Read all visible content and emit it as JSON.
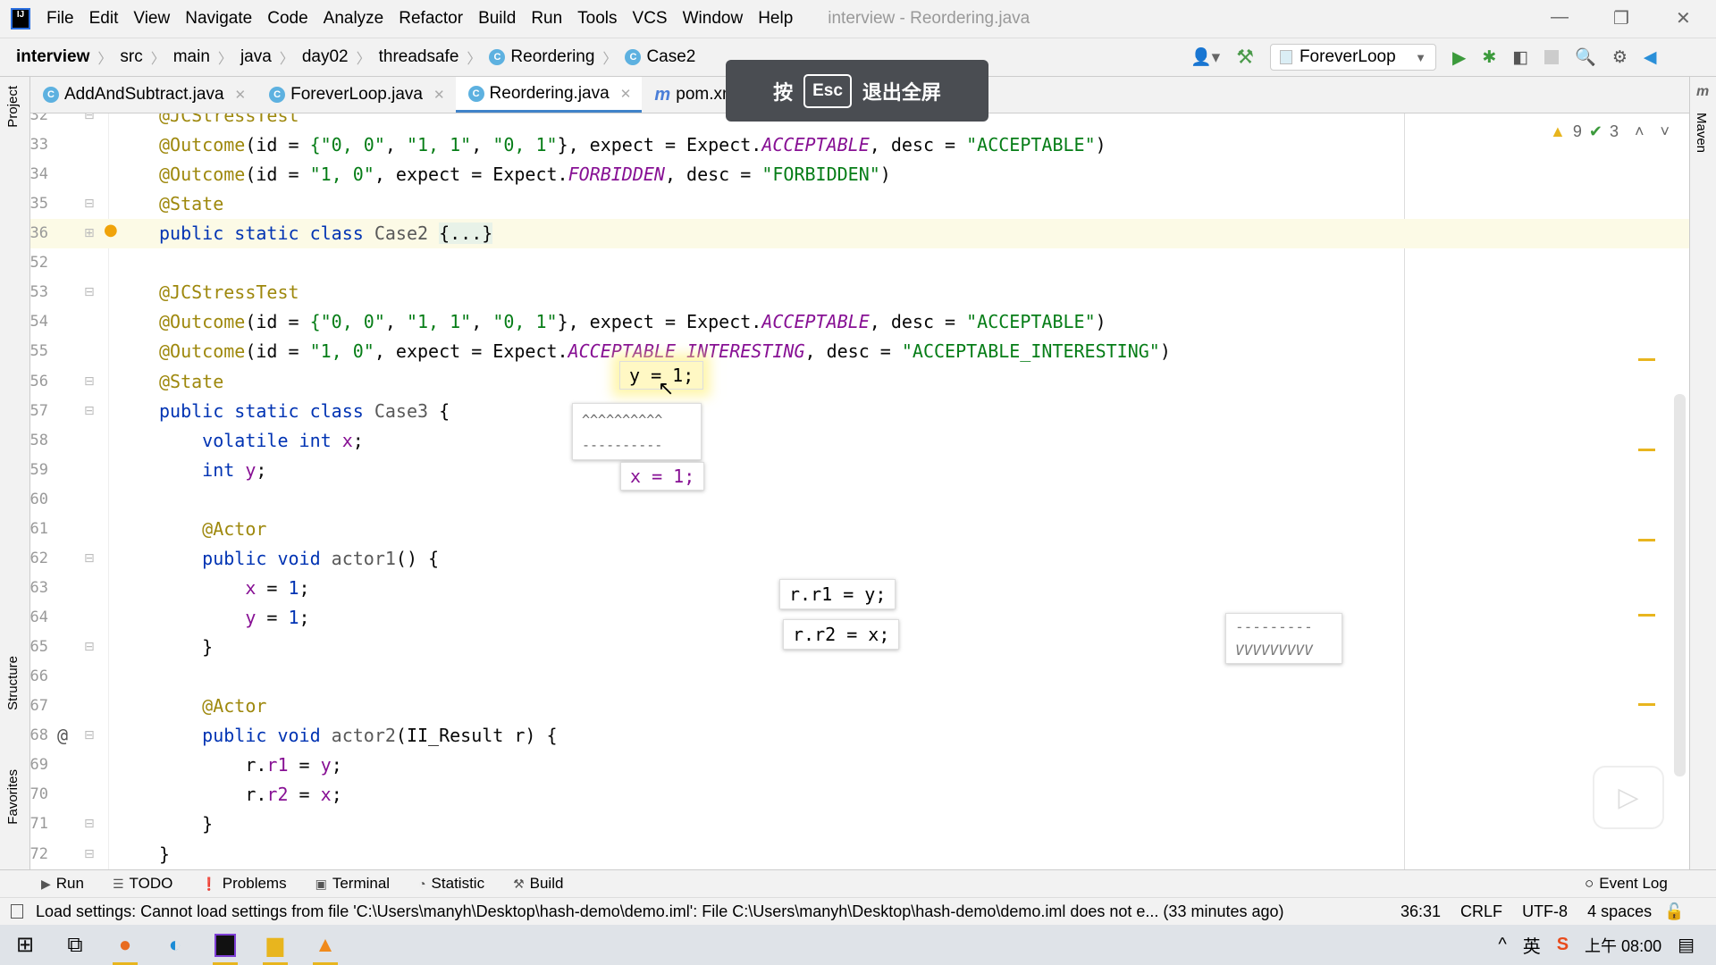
{
  "window": {
    "title": "interview - Reordering.java",
    "minimize": "—",
    "restore": "❐",
    "close": "✕"
  },
  "menu": [
    "File",
    "Edit",
    "View",
    "Navigate",
    "Code",
    "Analyze",
    "Refactor",
    "Build",
    "Run",
    "Tools",
    "VCS",
    "Window",
    "Help"
  ],
  "breadcrumb": [
    "interview",
    "src",
    "main",
    "java",
    "day02",
    "threadsafe",
    "Reordering",
    "Case2"
  ],
  "toolbar": {
    "run_config": "ForeverLoop"
  },
  "tabs": [
    {
      "label": "AddAndSubtract.java",
      "icon": "C"
    },
    {
      "label": "ForeverLoop.java",
      "icon": "C"
    },
    {
      "label": "Reordering.java",
      "icon": "C",
      "active": true
    },
    {
      "label": "pom.xml (interview)",
      "icon": "m"
    }
  ],
  "overlay": {
    "prefix": "按",
    "key": "Esc",
    "suffix": "退出全屏"
  },
  "inspections": {
    "warnings": "9",
    "weak_warnings": "3"
  },
  "side": {
    "project": "Project",
    "structure": "Structure",
    "favorites": "Favorites",
    "maven": "Maven"
  },
  "code": {
    "lines": [
      {
        "n": "32",
        "t": [
          [
            "@JCStressTest",
            "a"
          ]
        ]
      },
      {
        "n": "33",
        "t": [
          [
            "@Outcome",
            "a"
          ],
          [
            "(id = ",
            "p"
          ],
          [
            "{\"0, 0\"",
            "s"
          ],
          [
            ", ",
            "p"
          ],
          [
            "\"1, 1\"",
            "s"
          ],
          [
            ", ",
            "p"
          ],
          [
            "\"0, 1\"",
            "s"
          ],
          [
            "}, expect = Expect.",
            "p"
          ],
          [
            "ACCEPTABLE",
            "c"
          ],
          [
            ", desc = ",
            "p"
          ],
          [
            "\"ACCEPTABLE\"",
            "s"
          ],
          [
            ")",
            "p"
          ]
        ]
      },
      {
        "n": "34",
        "t": [
          [
            "@Outcome",
            "a"
          ],
          [
            "(id = ",
            "p"
          ],
          [
            "\"1, 0\"",
            "s"
          ],
          [
            ", expect = Expect.",
            "p"
          ],
          [
            "FORBIDDEN",
            "c"
          ],
          [
            ", desc = ",
            "p"
          ],
          [
            "\"FORBIDDEN\"",
            "s"
          ],
          [
            ")",
            "p"
          ]
        ]
      },
      {
        "n": "35",
        "t": [
          [
            "@State",
            "a"
          ]
        ]
      },
      {
        "n": "36",
        "cur": true,
        "t": [
          [
            "public static class ",
            "k"
          ],
          [
            "Case2 ",
            "g"
          ],
          [
            "{...}",
            "fold"
          ]
        ]
      },
      {
        "n": "52",
        "t": []
      },
      {
        "n": "53",
        "t": [
          [
            "@JCStressTest",
            "a"
          ]
        ]
      },
      {
        "n": "54",
        "t": [
          [
            "@Outcome",
            "a"
          ],
          [
            "(id = ",
            "p"
          ],
          [
            "{\"0, 0\"",
            "s"
          ],
          [
            ", ",
            "p"
          ],
          [
            "\"1, 1\"",
            "s"
          ],
          [
            ", ",
            "p"
          ],
          [
            "\"0, 1\"",
            "s"
          ],
          [
            "}, expect = Expect.",
            "p"
          ],
          [
            "ACCEPTABLE",
            "c"
          ],
          [
            ", desc = ",
            "p"
          ],
          [
            "\"ACCEPTABLE\"",
            "s"
          ],
          [
            ")",
            "p"
          ]
        ]
      },
      {
        "n": "55",
        "t": [
          [
            "@Outcome",
            "a"
          ],
          [
            "(id = ",
            "p"
          ],
          [
            "\"1, 0\"",
            "s"
          ],
          [
            ", expect = Expect.",
            "p"
          ],
          [
            "ACCEPTABLE_INTERESTING",
            "c"
          ],
          [
            ", desc = ",
            "p"
          ],
          [
            "\"ACCEPTABLE_INTERESTING\"",
            "s"
          ],
          [
            ")",
            "p"
          ]
        ]
      },
      {
        "n": "56",
        "t": [
          [
            "@State",
            "a"
          ]
        ]
      },
      {
        "n": "57",
        "t": [
          [
            "public static class ",
            "k"
          ],
          [
            "Case3 ",
            "g"
          ],
          [
            "{",
            "p"
          ]
        ]
      },
      {
        "n": "58",
        "t": [
          [
            "    volatile int ",
            "k"
          ],
          [
            "x",
            "f"
          ],
          [
            ";",
            "p"
          ]
        ]
      },
      {
        "n": "59",
        "t": [
          [
            "    int ",
            "k"
          ],
          [
            "y",
            "f"
          ],
          [
            ";",
            "p"
          ]
        ]
      },
      {
        "n": "60",
        "t": []
      },
      {
        "n": "61",
        "t": [
          [
            "    @Actor",
            "a"
          ]
        ]
      },
      {
        "n": "62",
        "t": [
          [
            "    public void ",
            "k"
          ],
          [
            "actor1",
            "g"
          ],
          [
            "() {",
            "p"
          ]
        ]
      },
      {
        "n": "63",
        "t": [
          [
            "        x",
            "f"
          ],
          [
            " = ",
            "p"
          ],
          [
            "1",
            "k"
          ],
          [
            ";",
            "p"
          ]
        ]
      },
      {
        "n": "64",
        "t": [
          [
            "        y",
            "f"
          ],
          [
            " = ",
            "p"
          ],
          [
            "1",
            "k"
          ],
          [
            ";",
            "p"
          ]
        ]
      },
      {
        "n": "65",
        "t": [
          [
            "    }",
            "p"
          ]
        ]
      },
      {
        "n": "66",
        "t": []
      },
      {
        "n": "67",
        "t": [
          [
            "    @Actor",
            "a"
          ]
        ]
      },
      {
        "n": "68",
        "t": [
          [
            "    public void ",
            "k"
          ],
          [
            "actor2",
            "g"
          ],
          [
            "(II_Result r) {",
            "p"
          ]
        ]
      },
      {
        "n": "69",
        "t": [
          [
            "        r.",
            "p"
          ],
          [
            "r1",
            "f"
          ],
          [
            " = ",
            "p"
          ],
          [
            "y",
            "f"
          ],
          [
            ";",
            "p"
          ]
        ]
      },
      {
        "n": "70",
        "t": [
          [
            "        r.",
            "p"
          ],
          [
            "r2",
            "f"
          ],
          [
            " = ",
            "p"
          ],
          [
            "x",
            "f"
          ],
          [
            ";",
            "p"
          ]
        ]
      },
      {
        "n": "71",
        "t": [
          [
            "    }",
            "p"
          ]
        ]
      },
      {
        "n": "72",
        "t": [
          [
            "}",
            "p"
          ]
        ]
      }
    ]
  },
  "popups": {
    "y1": "y = 1;",
    "carets": "^^^^^^^^^^",
    "dashes1": "----------",
    "x1": "x = 1;",
    "rr1": "r.r1 = y;",
    "rr2": "r.r2 = x;",
    "dashes2": "---------",
    "vees": "VVVVVVVVV"
  },
  "bottom_tools": [
    "Run",
    "TODO",
    "Problems",
    "Terminal",
    "Statistic",
    "Build"
  ],
  "event_log": "Event Log",
  "status": {
    "message": "Load settings: Cannot load settings from file 'C:\\Users\\manyh\\Desktop\\hash-demo\\demo.iml': File C:\\Users\\manyh\\Desktop\\hash-demo\\demo.iml does not e... (33 minutes ago)",
    "position": "36:31",
    "line_sep": "CRLF",
    "encoding": "UTF-8",
    "indent": "4 spaces"
  },
  "tray": {
    "ime": "英",
    "clock": "上午 08:00"
  },
  "colors": {
    "keyword": "#0033b3",
    "annotation": "#9e880d",
    "string": "#067d17",
    "field": "#871094",
    "accent": "#4083c9",
    "warning": "#e8b51e"
  }
}
